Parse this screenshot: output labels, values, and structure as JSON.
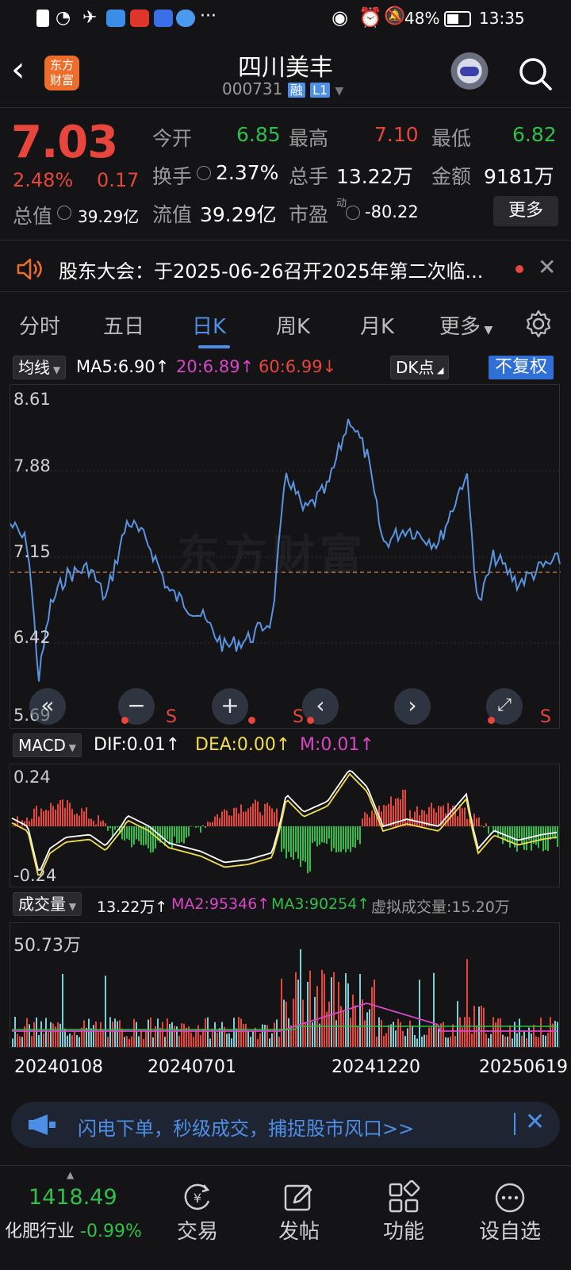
{
  "status": {
    "battery": "48%",
    "time": "13:35"
  },
  "header": {
    "logo_text_top": "东方",
    "logo_text_bottom": "财富",
    "stock_name": "四川美丰",
    "stock_code": "000731",
    "badge_rong": "融",
    "badge_level": "L1"
  },
  "quote": {
    "price": "7.03",
    "change_pct": "2.48%",
    "change_amt": "0.17",
    "open_label": "今开",
    "open": "6.85",
    "high_label": "最高",
    "high": "7.10",
    "low_label": "最低",
    "low": "6.82",
    "turnover_label": "换手",
    "turnover": "2.37%",
    "volume_label": "总手",
    "volume": "13.22万",
    "amount_label": "金额",
    "amount": "9181万",
    "mktcap_label": "总值",
    "mktcap": "39.29亿",
    "float_label": "流值",
    "float": "39.29亿",
    "pe_label": "市盈",
    "pe_sup": "动",
    "pe": "-80.22",
    "more_button": "更多"
  },
  "notice": {
    "text": "股东大会：于2025-06-26召开2025年第二次临..."
  },
  "tabs": [
    "分时",
    "五日",
    "日K",
    "周K",
    "月K",
    "更多"
  ],
  "active_tab": 2,
  "kline": {
    "ma_selector": "均线",
    "ma5": "MA5:6.90",
    "ma20": "20:6.89",
    "ma60": "60:6.99",
    "dk_button": "DK点",
    "adjust_button": "不复权",
    "y_labels": [
      "8.61",
      "7.88",
      "7.15",
      "6.42",
      "5.69"
    ],
    "watermark": "东方财富",
    "marker_s": "S"
  },
  "macd": {
    "selector": "MACD",
    "dif": "DIF:0.01",
    "dea": "DEA:0.00",
    "m": "M:0.01",
    "y_top": "0.24",
    "y_bottom": "-0.24"
  },
  "volume": {
    "selector": "成交量",
    "vol": "13.22万",
    "ma2": "MA2:95346",
    "ma3": "MA3:90254",
    "virtual": "虚拟成交量:15.20万",
    "y_top": "50.73万",
    "dates": [
      "20240108",
      "20240701",
      "20241220",
      "20250619"
    ]
  },
  "banner": {
    "text": "闪电下单，秒级成交，捕捉股市风口>>"
  },
  "bottom": {
    "index_value": "1418.49",
    "index_name": "化肥行业",
    "index_change": "-0.99%",
    "nav": [
      "交易",
      "发帖",
      "功能",
      "设自选"
    ]
  },
  "colors": {
    "up": "#e8453c",
    "down": "#2fbf4a",
    "accent": "#4d8fe6",
    "line": "#5a93e0"
  }
}
